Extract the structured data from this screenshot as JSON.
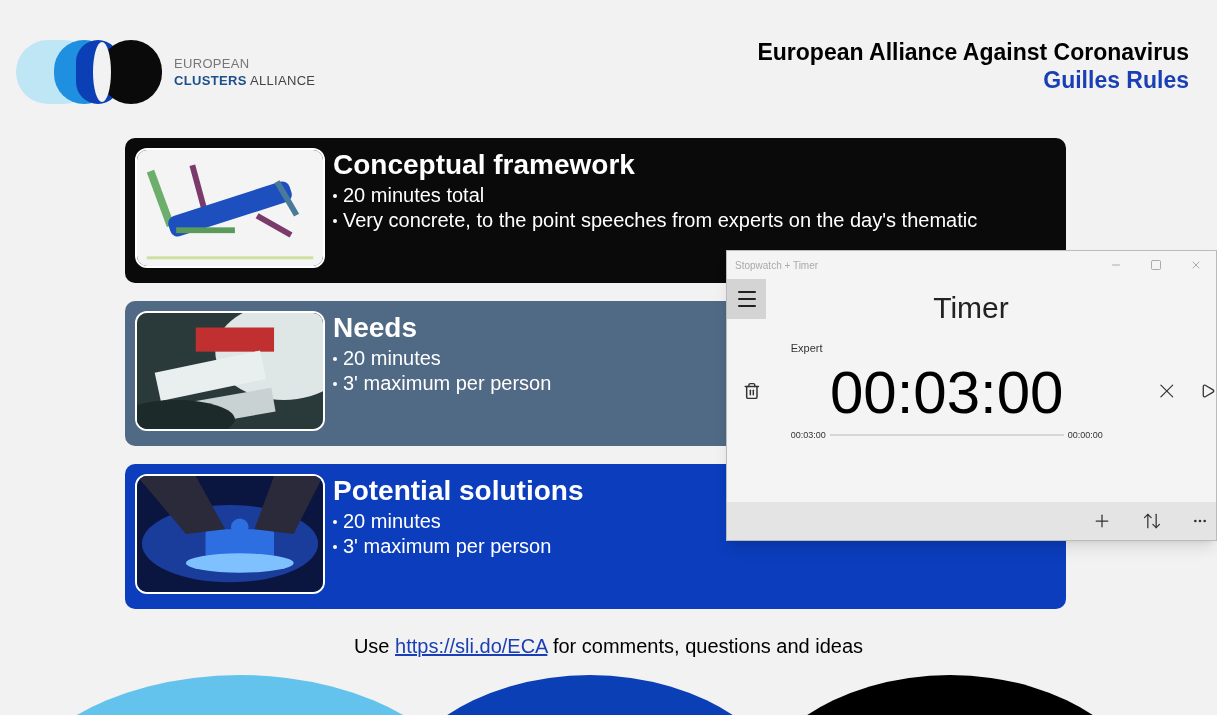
{
  "header": {
    "logo": {
      "line1": "EUROPEAN",
      "line2_bold": "CLUSTERS",
      "line2_rest": "ALLIANCE"
    },
    "title": "European Alliance Against Coronavirus",
    "subtitle": "Guilles Rules"
  },
  "cards": [
    {
      "kind": "black",
      "title": "Conceptual framework",
      "bullets": [
        "20 minutes total",
        "Very concrete, to the point speeches from experts on the day's thematic"
      ]
    },
    {
      "kind": "slate",
      "title": "Needs",
      "bullets": [
        "20 minutes",
        "3' maximum per person"
      ]
    },
    {
      "kind": "blue",
      "title": "Potential solutions",
      "bullets": [
        "20 minutes",
        "3' maximum per person"
      ]
    }
  ],
  "footer": {
    "before": "Use",
    "link": "https://sli.do/ECA",
    "after": "for comments, questions and ideas"
  },
  "timer_window": {
    "title": "Stopwatch + Timer",
    "heading": "Timer",
    "timer": {
      "name": "Expert",
      "time": "00:03:00",
      "start": "00:03:00",
      "end": "00:00:00"
    }
  }
}
